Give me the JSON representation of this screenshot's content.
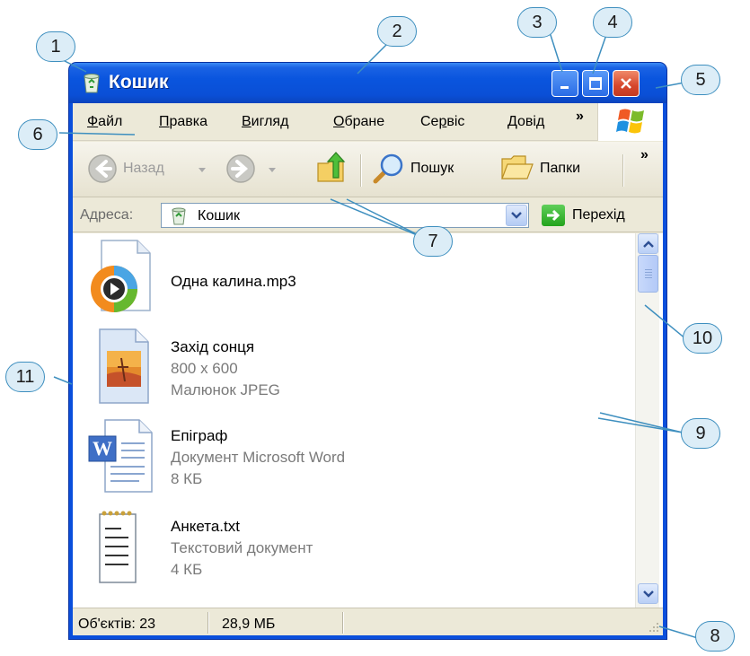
{
  "window": {
    "title": "Кошик",
    "colors": {
      "titlebar": "#0a4fdc",
      "close_button": "#d6462b",
      "client": "#ece9d8"
    }
  },
  "menubar": {
    "items": [
      {
        "label": "Файл",
        "accel": "Ф",
        "rest": "айл"
      },
      {
        "label": "Правка",
        "accel": "П",
        "rest": "равка"
      },
      {
        "label": "Вигляд",
        "accel": "В",
        "rest": "игляд"
      },
      {
        "label": "Обране",
        "accel": "О",
        "rest": "бране"
      },
      {
        "label": "Сервіс",
        "accel": "р",
        "before": "Се",
        "rest": "віс"
      },
      {
        "label": "Довід",
        "accel": "Д",
        "rest": "овід"
      }
    ],
    "overflow": "»"
  },
  "toolbar": {
    "back_label": "Назад",
    "search_label": "Пошук",
    "folders_label": "Папки",
    "overflow": "»"
  },
  "addressbar": {
    "label": "Адреса:",
    "value": "Кошик",
    "go_label": "Перехід"
  },
  "files": [
    {
      "name": "Одна калина.mp3",
      "icon": "media-player-icon"
    },
    {
      "name": "Захід сонця",
      "line2": "800 x 600",
      "line3": "Малюнок JPEG",
      "icon": "jpeg-image-icon"
    },
    {
      "name": "Епіграф",
      "line2": "Документ Microsoft Word",
      "line3": "8 КБ",
      "icon": "word-document-icon"
    },
    {
      "name": "Анкета.txt",
      "line2": "Текстовий документ",
      "line3": "4 КБ",
      "icon": "text-document-icon"
    }
  ],
  "statusbar": {
    "objects": "Об'єктів: 23",
    "size": "28,9 МБ"
  },
  "callouts": [
    "1",
    "2",
    "3",
    "4",
    "5",
    "6",
    "7",
    "8",
    "9",
    "10",
    "11"
  ]
}
